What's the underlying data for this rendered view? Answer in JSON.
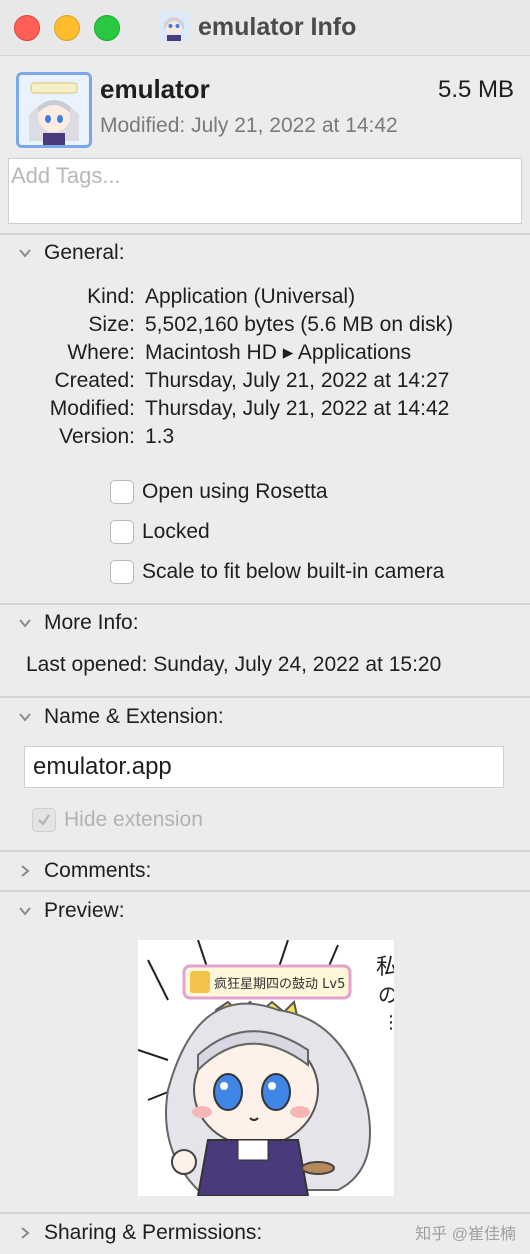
{
  "window": {
    "title": "emulator Info"
  },
  "header": {
    "name": "emulator",
    "size": "5.5 MB",
    "modified_label": "Modified:",
    "modified_value": "July 21, 2022 at 14:42"
  },
  "tags": {
    "placeholder": "Add Tags..."
  },
  "general": {
    "label": "General:",
    "fields": [
      {
        "key": "Kind:",
        "value": "Application (Universal)"
      },
      {
        "key": "Size:",
        "value": "5,502,160 bytes (5.6 MB on disk)"
      },
      {
        "key": "Where:",
        "value": "Macintosh HD ▸ Applications"
      },
      {
        "key": "Created:",
        "value": "Thursday, July 21, 2022 at 14:27"
      },
      {
        "key": "Modified:",
        "value": "Thursday, July 21, 2022 at 14:42"
      },
      {
        "key": "Version:",
        "value": "1.3"
      }
    ],
    "checkboxes": [
      {
        "label": "Open using Rosetta",
        "checked": false
      },
      {
        "label": "Locked",
        "checked": false
      },
      {
        "label": "Scale to fit below built-in camera",
        "checked": false
      }
    ]
  },
  "more_info": {
    "label": "More Info:",
    "last_opened": "Last opened: Sunday, July 24, 2022 at 15:20"
  },
  "name_extension": {
    "label": "Name & Extension:",
    "value": "emulator.app",
    "hide_extension_label": "Hide extension",
    "hide_extension_checked": true
  },
  "comments": {
    "label": "Comments:"
  },
  "preview": {
    "label": "Preview:",
    "image_badge_text": "疯狂星期四の鼓动 Lv5"
  },
  "sharing": {
    "label": "Sharing & Permissions:"
  },
  "watermark": "知乎 @崔佳楠"
}
